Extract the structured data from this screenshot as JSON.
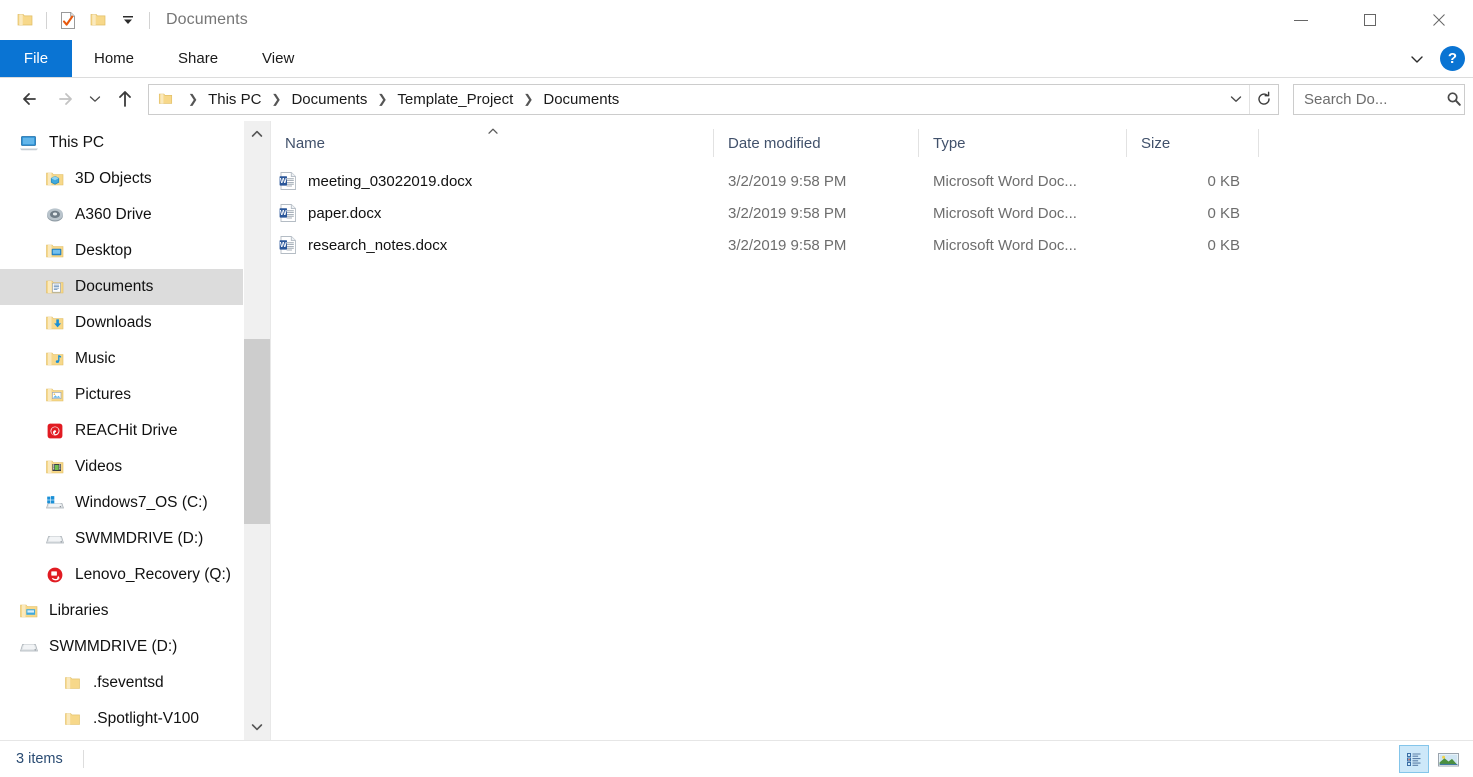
{
  "window": {
    "title": "Documents",
    "quick_access": [
      {
        "name": "folder-icon",
        "label": "Folder"
      },
      {
        "name": "properties-icon",
        "label": "Properties"
      },
      {
        "name": "new-folder-icon",
        "label": "New folder"
      },
      {
        "name": "customize-quick-access-icon",
        "label": "Customize Quick Access Toolbar"
      }
    ],
    "controls": {
      "minimize": "Minimize",
      "maximize": "Maximize",
      "close": "Close"
    }
  },
  "ribbon": {
    "file_tab": "File",
    "tabs": [
      "Home",
      "Share",
      "View"
    ],
    "expand_label": "Expand the Ribbon",
    "help_label": "?",
    "accent_color": "#0a74d3"
  },
  "address": {
    "back_label": "Back",
    "forward_label": "Forward",
    "recent_label": "Recent locations",
    "up_label": "Up",
    "breadcrumbs": [
      "This PC",
      "Documents",
      "Template_Project",
      "Documents"
    ],
    "dropdown_label": "Previous locations",
    "refresh_label": "Refresh"
  },
  "search": {
    "value": "",
    "placeholder": "Search Do...",
    "icon": "search-icon"
  },
  "sidebar": {
    "items": [
      {
        "label": "This PC",
        "icon": "this-pc-icon",
        "level": 1,
        "selected": false
      },
      {
        "label": "3D Objects",
        "icon": "folder-3d-objects-icon",
        "level": 2,
        "selected": false
      },
      {
        "label": "A360 Drive",
        "icon": "a360-drive-icon",
        "level": 2,
        "selected": false
      },
      {
        "label": "Desktop",
        "icon": "folder-desktop-icon",
        "level": 2,
        "selected": false
      },
      {
        "label": "Documents",
        "icon": "folder-documents-icon",
        "level": 2,
        "selected": true
      },
      {
        "label": "Downloads",
        "icon": "folder-downloads-icon",
        "level": 2,
        "selected": false
      },
      {
        "label": "Music",
        "icon": "folder-music-icon",
        "level": 2,
        "selected": false
      },
      {
        "label": "Pictures",
        "icon": "folder-pictures-icon",
        "level": 2,
        "selected": false
      },
      {
        "label": "REACHit Drive",
        "icon": "reachit-drive-icon",
        "level": 2,
        "selected": false
      },
      {
        "label": "Videos",
        "icon": "folder-videos-icon",
        "level": 2,
        "selected": false
      },
      {
        "label": "Windows7_OS (C:)",
        "icon": "windows-drive-icon",
        "level": 2,
        "selected": false
      },
      {
        "label": "SWMMDRIVE (D:)",
        "icon": "drive-icon",
        "level": 2,
        "selected": false
      },
      {
        "label": "Lenovo_Recovery (Q:)",
        "icon": "recovery-drive-icon",
        "level": 2,
        "selected": false
      },
      {
        "label": "Libraries",
        "icon": "libraries-icon",
        "level": 1,
        "selected": false
      },
      {
        "label": "SWMMDRIVE (D:)",
        "icon": "drive-icon",
        "level": 1,
        "selected": false
      },
      {
        "label": ".fseventsd",
        "icon": "folder-icon",
        "level": 2,
        "selected": false
      },
      {
        "label": ".Spotlight-V100",
        "icon": "folder-icon",
        "level": 2,
        "selected": false
      }
    ],
    "scrollbar": {
      "up_label": "Scroll up",
      "down_label": "Scroll down"
    }
  },
  "file_list": {
    "columns": [
      {
        "key": "name",
        "label": "Name",
        "sorted": "asc"
      },
      {
        "key": "date",
        "label": "Date modified",
        "sorted": ""
      },
      {
        "key": "type",
        "label": "Type",
        "sorted": ""
      },
      {
        "key": "size",
        "label": "Size",
        "sorted": ""
      }
    ],
    "sort_indicator": "⌃",
    "rows": [
      {
        "icon": "word-document-icon",
        "name": "meeting_03022019.docx",
        "date": "3/2/2019 9:58 PM",
        "type": "Microsoft Word Doc...",
        "size": "0 KB"
      },
      {
        "icon": "word-document-icon",
        "name": "paper.docx",
        "date": "3/2/2019 9:58 PM",
        "type": "Microsoft Word Doc...",
        "size": "0 KB"
      },
      {
        "icon": "word-document-icon",
        "name": "research_notes.docx",
        "date": "3/2/2019 9:58 PM",
        "type": "Microsoft Word Doc...",
        "size": "0 KB"
      }
    ]
  },
  "status": {
    "item_count": "3 items",
    "views": [
      {
        "name": "details-view-button",
        "label": "Details view",
        "active": true
      },
      {
        "name": "large-icons-view-button",
        "label": "Large icons view",
        "active": false
      }
    ]
  }
}
